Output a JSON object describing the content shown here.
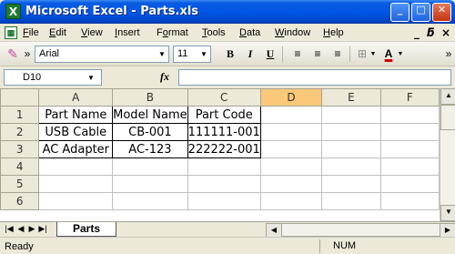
{
  "window": {
    "title": "Microsoft Excel - Parts.xls",
    "app_icon_glyph": "X",
    "buttons": {
      "minimize": "_",
      "maximize": "□",
      "close": "✕"
    }
  },
  "menu": {
    "items": [
      {
        "ul": "F",
        "rest": "ile"
      },
      {
        "ul": "E",
        "rest": "dit"
      },
      {
        "ul": "V",
        "rest": "iew"
      },
      {
        "ul": "I",
        "rest": "nsert"
      },
      {
        "pre": "F",
        "ul": "o",
        "rest": "rmat"
      },
      {
        "ul": "T",
        "rest": "ools"
      },
      {
        "ul": "D",
        "rest": "ata"
      },
      {
        "ul": "W",
        "rest": "indow"
      },
      {
        "ul": "H",
        "rest": "elp"
      }
    ],
    "doc_minimize": "_",
    "doc_restore": "🗗",
    "doc_close": "×"
  },
  "toolbar": {
    "font_name": "Arial",
    "font_size": "11",
    "bold": "B",
    "italic": "I",
    "underline": "U",
    "overflow": "»"
  },
  "formula_bar": {
    "cell_ref": "D10",
    "fx": "fx",
    "content": ""
  },
  "grid": {
    "columns": [
      "A",
      "B",
      "C",
      "D",
      "E",
      "F"
    ],
    "selected_column": "D",
    "rows": [
      {
        "num": "1",
        "cells": [
          "Part Name",
          "Model Name",
          "Part Code",
          "",
          "",
          ""
        ]
      },
      {
        "num": "2",
        "cells": [
          "USB Cable",
          "CB-001",
          "111111-001",
          "",
          "",
          ""
        ]
      },
      {
        "num": "3",
        "cells": [
          "AC Adapter",
          "AC-123",
          "222222-001",
          "",
          "",
          ""
        ]
      },
      {
        "num": "4",
        "cells": [
          "",
          "",
          "",
          "",
          "",
          ""
        ]
      },
      {
        "num": "5",
        "cells": [
          "",
          "",
          "",
          "",
          "",
          ""
        ]
      },
      {
        "num": "6",
        "cells": [
          "",
          "",
          "",
          "",
          "",
          ""
        ]
      }
    ]
  },
  "sheets": {
    "active": "Parts",
    "nav": [
      "|◀",
      "◀",
      "▶",
      "▶|"
    ]
  },
  "status": {
    "left": "Ready",
    "num": "NUM"
  },
  "colors": {
    "titlebar": "#0055e5",
    "selected_header": "#f9c979",
    "excel_green": "#1d7a2e"
  }
}
